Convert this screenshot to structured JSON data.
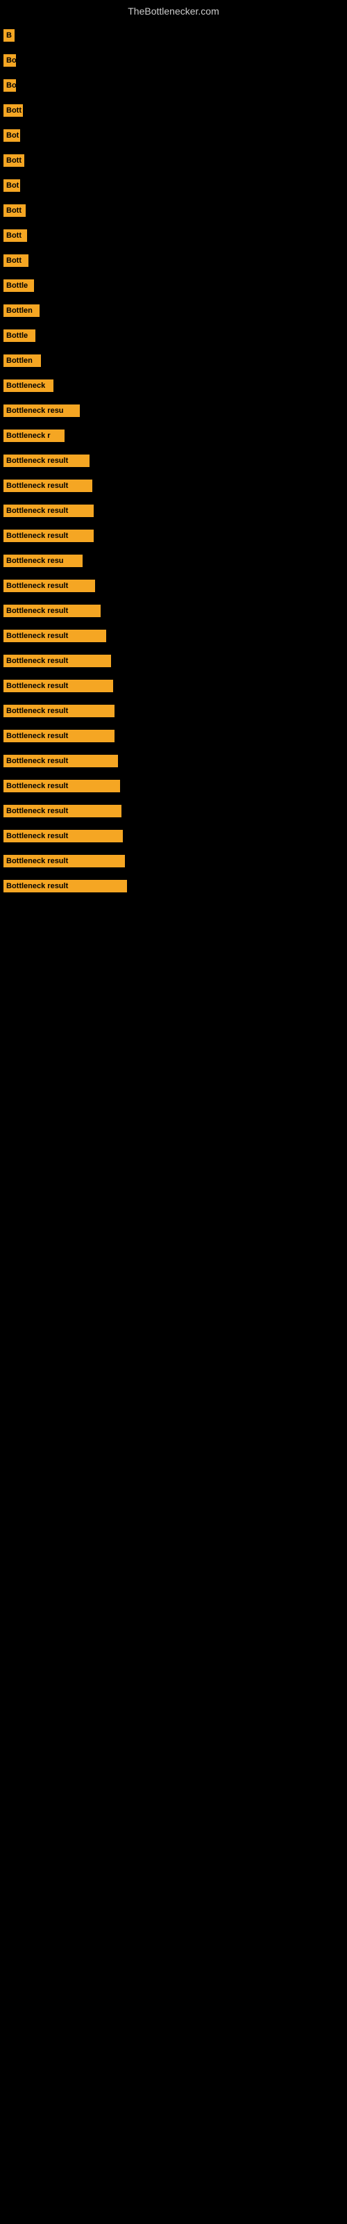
{
  "page": {
    "title": "TheBottlenecker.com",
    "background": "#000000"
  },
  "items": [
    {
      "id": 1,
      "label": "B",
      "width": 16
    },
    {
      "id": 2,
      "label": "Bo",
      "width": 18
    },
    {
      "id": 3,
      "label": "Bo",
      "width": 18
    },
    {
      "id": 4,
      "label": "Bott",
      "width": 28
    },
    {
      "id": 5,
      "label": "Bot",
      "width": 24
    },
    {
      "id": 6,
      "label": "Bott",
      "width": 30
    },
    {
      "id": 7,
      "label": "Bot",
      "width": 24
    },
    {
      "id": 8,
      "label": "Bott",
      "width": 32
    },
    {
      "id": 9,
      "label": "Bott",
      "width": 34
    },
    {
      "id": 10,
      "label": "Bott",
      "width": 36
    },
    {
      "id": 11,
      "label": "Bottle",
      "width": 44
    },
    {
      "id": 12,
      "label": "Bottlen",
      "width": 52
    },
    {
      "id": 13,
      "label": "Bottle",
      "width": 46
    },
    {
      "id": 14,
      "label": "Bottlen",
      "width": 54
    },
    {
      "id": 15,
      "label": "Bottleneck",
      "width": 72
    },
    {
      "id": 16,
      "label": "Bottleneck resu",
      "width": 110
    },
    {
      "id": 17,
      "label": "Bottleneck r",
      "width": 88
    },
    {
      "id": 18,
      "label": "Bottleneck result",
      "width": 124
    },
    {
      "id": 19,
      "label": "Bottleneck result",
      "width": 128
    },
    {
      "id": 20,
      "label": "Bottleneck result",
      "width": 130
    },
    {
      "id": 21,
      "label": "Bottleneck result",
      "width": 130
    },
    {
      "id": 22,
      "label": "Bottleneck resu",
      "width": 114
    },
    {
      "id": 23,
      "label": "Bottleneck result",
      "width": 132
    },
    {
      "id": 24,
      "label": "Bottleneck result",
      "width": 140
    },
    {
      "id": 25,
      "label": "Bottleneck result",
      "width": 148
    },
    {
      "id": 26,
      "label": "Bottleneck result",
      "width": 155
    },
    {
      "id": 27,
      "label": "Bottleneck result",
      "width": 158
    },
    {
      "id": 28,
      "label": "Bottleneck result",
      "width": 160
    },
    {
      "id": 29,
      "label": "Bottleneck result",
      "width": 160
    },
    {
      "id": 30,
      "label": "Bottleneck result",
      "width": 165
    },
    {
      "id": 31,
      "label": "Bottleneck result",
      "width": 168
    },
    {
      "id": 32,
      "label": "Bottleneck result",
      "width": 170
    },
    {
      "id": 33,
      "label": "Bottleneck result",
      "width": 172
    },
    {
      "id": 34,
      "label": "Bottleneck result",
      "width": 175
    },
    {
      "id": 35,
      "label": "Bottleneck result",
      "width": 178
    }
  ]
}
